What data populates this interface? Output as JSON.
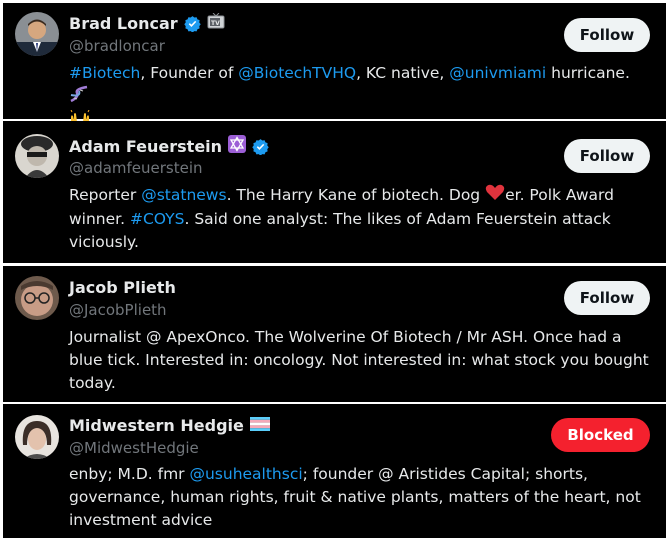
{
  "users": [
    {
      "name": "Brad Loncar",
      "handle": "@bradloncar",
      "button": "Follow",
      "bio": [
        {
          "t": "#Biotech",
          "link": true
        },
        {
          "t": ", Founder of "
        },
        {
          "t": "@BiotechTVHQ",
          "link": true
        },
        {
          "t": ", KC native, "
        },
        {
          "t": "@univmiami",
          "link": true
        },
        {
          "t": " hurricane."
        }
      ]
    },
    {
      "name": "Adam Feuerstein",
      "handle": "@adamfeuerstein",
      "button": "Follow",
      "bio": [
        {
          "t": "Reporter "
        },
        {
          "t": "@statnews",
          "link": true
        },
        {
          "t": ". The Harry Kane of biotech. Dog "
        },
        {
          "t": "er. Polk Award winner. "
        },
        {
          "t": "#COYS",
          "link": true
        },
        {
          "t": ". Said one analyst: The likes of Adam Feuerstein attack viciously."
        }
      ]
    },
    {
      "name": "Jacob Plieth",
      "handle": "@JacobPlieth",
      "button": "Follow",
      "bio": [
        {
          "t": "Journalist @ ApexOnco. The Wolverine Of Biotech / Mr ASH. Once had a blue tick. Interested in: oncology. Not interested in: what stock you bought today."
        }
      ]
    },
    {
      "name": "Midwestern Hedgie",
      "handle": "@MidwestHedgie",
      "button": "Blocked",
      "bio": [
        {
          "t": "enby; M.D. fmr "
        },
        {
          "t": "@usuhealthsci",
          "link": true
        },
        {
          "t": "; founder @ Aristides Capital; shorts, governance, human rights, fruit & native plants, matters of the heart, not investment advice"
        }
      ]
    }
  ],
  "colors": {
    "link": "#1d9bf0",
    "verified": "#1d9bf0",
    "blocked": "#f4212e",
    "muted": "#71767b"
  },
  "icons": [
    "verified-badge-icon",
    "tv-emoji-icon",
    "dna-emoji-icon",
    "raised-hands-emoji-icon",
    "star-of-david-emoji-icon",
    "red-heart-emoji-icon",
    "transgender-flag-emoji-icon"
  ]
}
